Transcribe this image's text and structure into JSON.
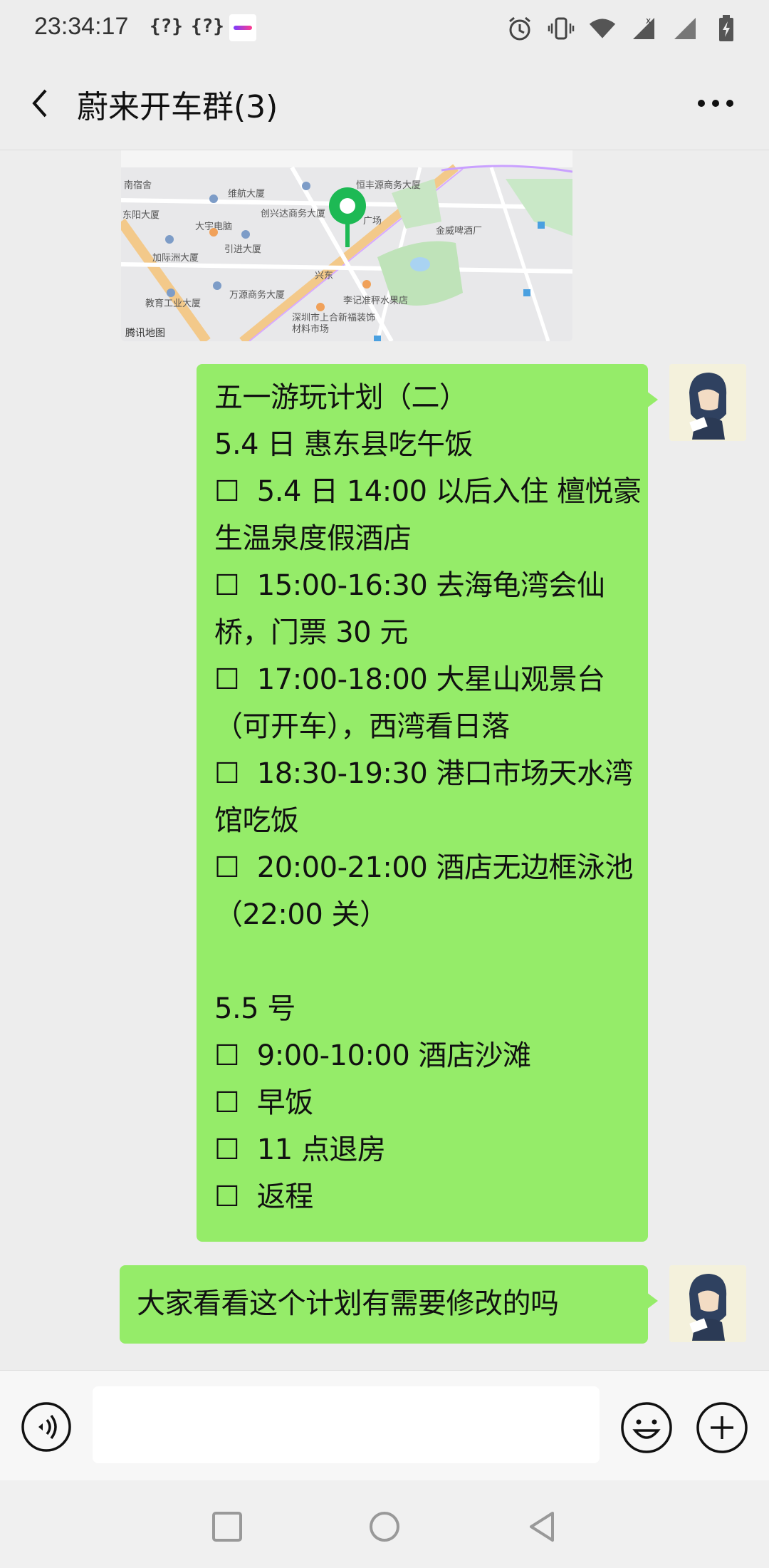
{
  "status_bar": {
    "time": "23:34:17",
    "extra_1": "{?}",
    "extra_2": "{?}",
    "icons": [
      "alarm-icon",
      "vibrate-icon",
      "wifi-icon",
      "signal-icon",
      "signal-icon",
      "battery-charging-icon"
    ]
  },
  "header": {
    "title": "蔚来开车群(3)",
    "back_icon": "chevron-left-icon",
    "more_icon": "more-dots-icon"
  },
  "map_message": {
    "watermark": "腾讯地图",
    "labels": [
      "南宿舍",
      "东阳大厦",
      "维航大厦",
      "创兴达商务大厦",
      "恒丰源商务大厦",
      "大宇电脑",
      "引进大厦",
      "加际洲大厦",
      "金威啤酒厂",
      "万源商务大厦",
      "教育工业大厦",
      "李记准秤水果店",
      "深圳市上合新福装饰材料市场",
      "广场",
      "兴东"
    ]
  },
  "plan_message": {
    "text": "五一游玩计划（二）\n5.4 日 惠东县吃午饭\n☐  5.4 日 14:00 以后入住 檀悦豪生温泉度假酒店\n☐  15:00-16:30 去海龟湾会仙桥，门票 30 元\n☐  17:00-18:00 大星山观景台（可开车），西湾看日落\n☐  18:30-19:30 港口市场天水湾馆吃饭\n☐  20:00-21:00 酒店无边框泳池（22:00 关）\n\n5.5 号\n☐  9:00-10:00 酒店沙滩\n☐  早饭\n☐  11 点退房\n☐  返程"
  },
  "ask_message": {
    "text": "大家看看这个计划有需要修改的吗"
  },
  "input_bar": {
    "value": "",
    "voice_icon": "voice-icon",
    "emoji_icon": "emoji-icon",
    "plus_icon": "plus-circle-icon"
  },
  "nav_bar": {
    "icons": [
      "recent-apps-icon",
      "home-icon",
      "back-icon"
    ]
  },
  "colors": {
    "bubble": "#95ec69",
    "background": "#ededed"
  }
}
